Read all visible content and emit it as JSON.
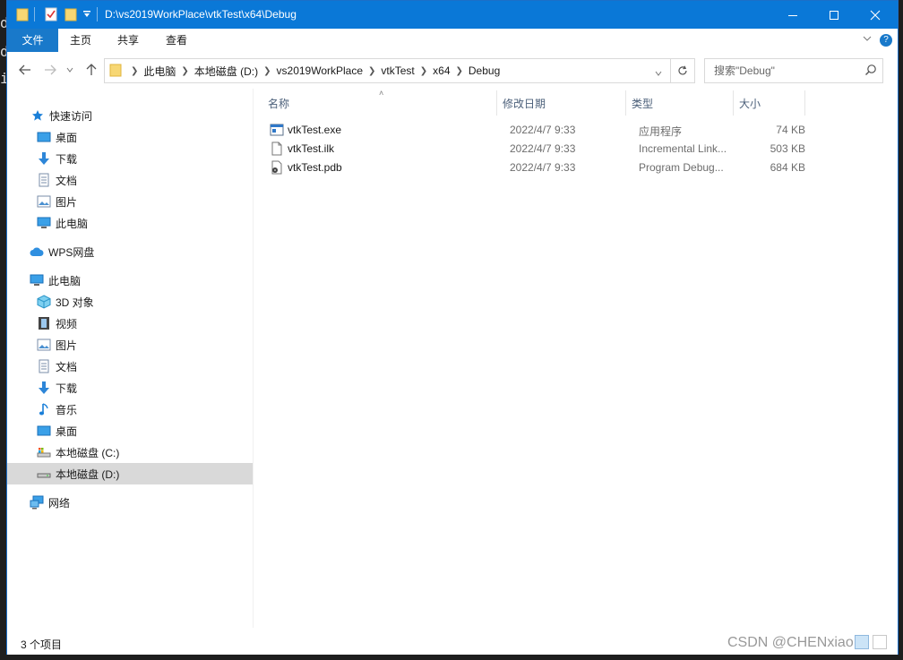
{
  "window": {
    "title": "D:\\vs2019WorkPlace\\vtkTest\\x64\\Debug",
    "accent": "#0a78d7"
  },
  "ribbon": {
    "tabs": [
      {
        "label": "文件"
      },
      {
        "label": "主页"
      },
      {
        "label": "共享"
      },
      {
        "label": "查看"
      }
    ]
  },
  "address": {
    "crumbs": [
      "此电脑",
      "本地磁盘 (D:)",
      "vs2019WorkPlace",
      "vtkTest",
      "x64",
      "Debug"
    ]
  },
  "search": {
    "placeholder": "搜索\"Debug\""
  },
  "sidebar": {
    "quick_access": "快速访问",
    "pinned": [
      "桌面",
      "下载",
      "文档",
      "图片",
      "此电脑"
    ],
    "wps": "WPS网盘",
    "this_pc": "此电脑",
    "pc_items": [
      "3D 对象",
      "视频",
      "图片",
      "文档",
      "下载",
      "音乐",
      "桌面",
      "本地磁盘 (C:)",
      "本地磁盘 (D:)"
    ],
    "network": "网络"
  },
  "columns": {
    "name": "名称",
    "modified": "修改日期",
    "type": "类型",
    "size": "大小"
  },
  "files": [
    {
      "name": "vtkTest.exe",
      "modified": "2022/4/7 9:33",
      "type": "应用程序",
      "size": "74 KB",
      "icon": "exe-icon"
    },
    {
      "name": "vtkTest.ilk",
      "modified": "2022/4/7 9:33",
      "type": "Incremental Link...",
      "size": "503 KB",
      "icon": "file-icon"
    },
    {
      "name": "vtkTest.pdb",
      "modified": "2022/4/7 9:33",
      "type": "Program Debug...",
      "size": "684 KB",
      "icon": "pdb-icon"
    }
  ],
  "status": {
    "count": "3 个项目"
  },
  "watermark": "CSDN @CHENxiao"
}
